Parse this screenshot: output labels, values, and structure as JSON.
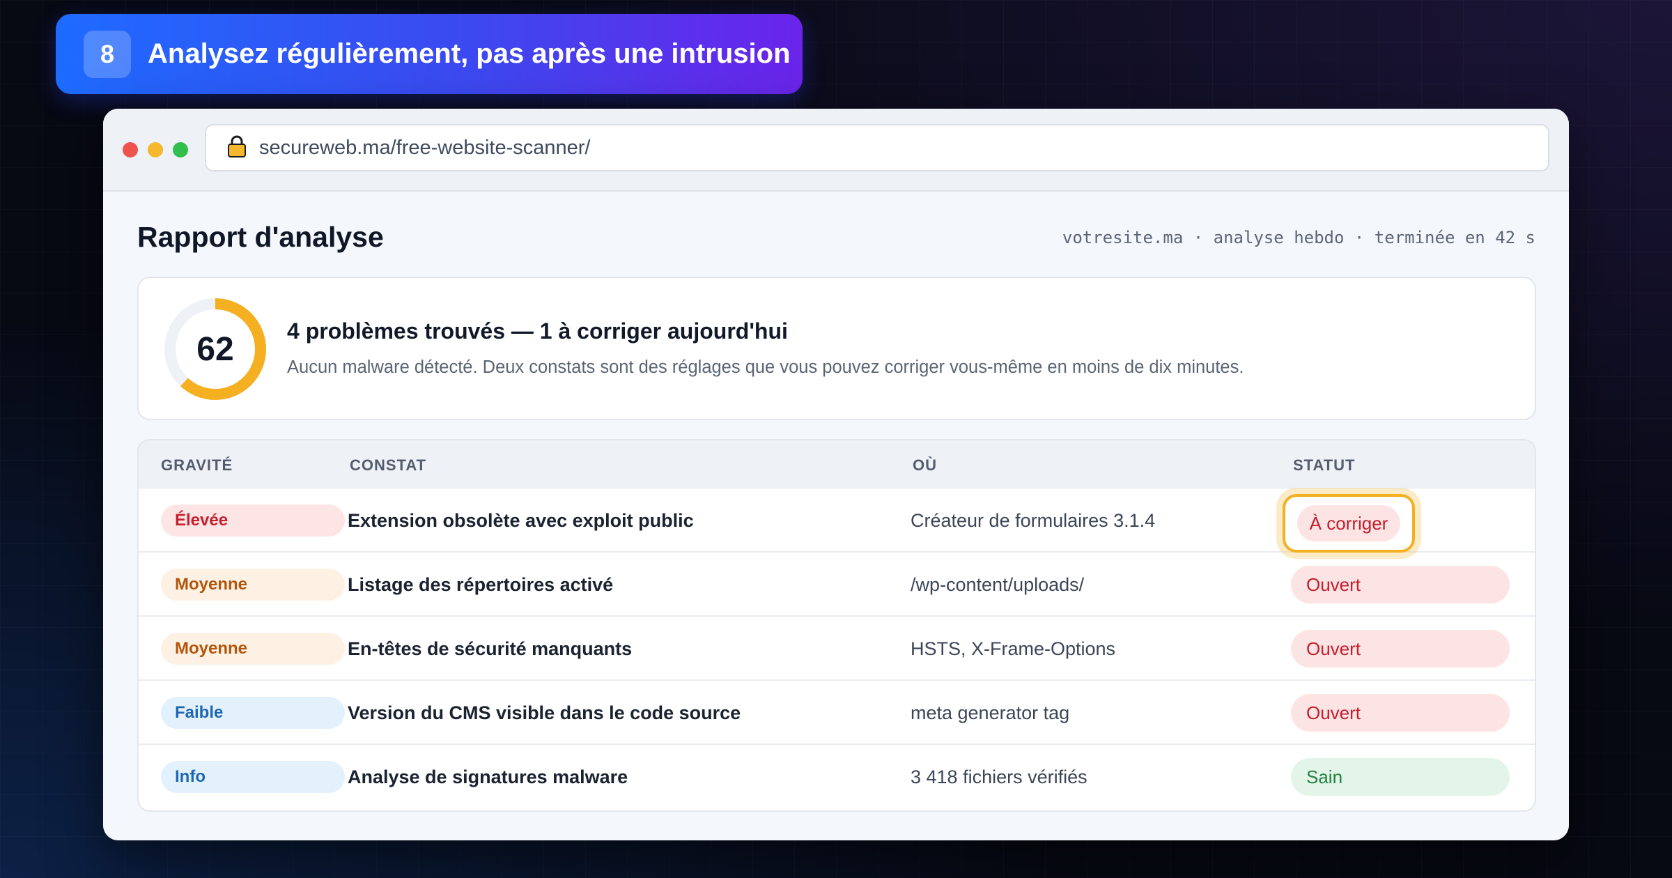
{
  "step": {
    "number": "8",
    "title": "Analysez régulièrement, pas après une intrusion"
  },
  "browser": {
    "url": "secureweb.ma/free-website-scanner/"
  },
  "report": {
    "title": "Rapport d'analyse",
    "meta": "votresite.ma · analyse hebdo · terminée en 42 s",
    "score": "62",
    "score_fraction": 0.62,
    "headline": "4 problèmes trouvés — 1 à corriger aujourd'hui",
    "subtext": "Aucun malware détecté. Deux constats sont des réglages que vous pouvez corriger vous-même en moins de dix minutes."
  },
  "table": {
    "headers": {
      "severity": "GRAVITÉ",
      "finding": "CONSTAT",
      "location": "OÙ",
      "status": "STATUT"
    },
    "rows": [
      {
        "severity": "Élevée",
        "finding": "Extension obsolète avec exploit public",
        "location": "Créateur de formulaires 3.1.4",
        "status": "À corriger"
      },
      {
        "severity": "Moyenne",
        "finding": "Listage des répertoires activé",
        "location": "/wp-content/uploads/",
        "status": "Ouvert"
      },
      {
        "severity": "Moyenne",
        "finding": "En-têtes de sécurité manquants",
        "location": "HSTS, X-Frame-Options",
        "status": "Ouvert"
      },
      {
        "severity": "Faible",
        "finding": "Version du CMS visible dans le code source",
        "location": "meta generator tag",
        "status": "Ouvert"
      },
      {
        "severity": "Info",
        "finding": "Analyse de signatures malware",
        "location": "3 418 fichiers vérifiés",
        "status": "Sain"
      }
    ]
  },
  "colors": {
    "score_ring": "#f5b021",
    "banner_start": "#1e6bff",
    "banner_end": "#6a24ea"
  },
  "icons": {
    "url_lock": "lock-icon"
  }
}
